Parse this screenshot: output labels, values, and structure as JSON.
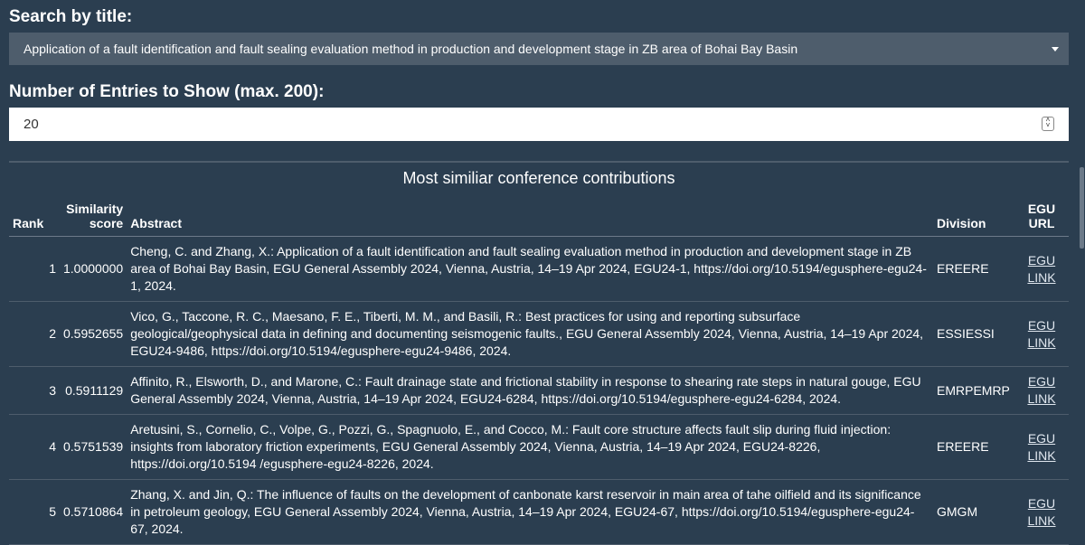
{
  "search_label": "Search by title:",
  "search_value": "Application of a fault identification and fault sealing evaluation method in production and development stage in ZB area of Bohai Bay Basin",
  "entries_label": "Number of Entries to Show (max. 200):",
  "entries_value": "20",
  "table_caption": "Most similiar conference contributions",
  "headers": {
    "rank": "Rank",
    "score_top": "Similarity",
    "score_bottom": "score",
    "abstract": "Abstract",
    "division": "Division",
    "url_top": "EGU",
    "url_bottom": "URL"
  },
  "link_top": "EGU",
  "link_bottom": "LINK",
  "rows": [
    {
      "rank": "1",
      "score": "1.0000000",
      "abstract": "Cheng, C. and Zhang, X.: Application of a fault identification and fault sealing evaluation method in production and development stage in ZB area of Bohai Bay Basin, EGU General Assembly 2024, Vienna, Austria, 14–19 Apr 2024, EGU24-1, https://doi.org/10.5194/egusphere-egu24-1, 2024.",
      "division": "EREERE"
    },
    {
      "rank": "2",
      "score": "0.5952655",
      "abstract": "Vico, G., Taccone, R. C., Maesano, F. E., Tiberti, M. M., and Basili, R.: Best practices for using and reporting subsurface geological/geophysical data in defining and documenting seismogenic faults., EGU General Assembly 2024, Vienna, Austria, 14–19 Apr 2024, EGU24-9486, https://doi.org/10.5194/egusphere-egu24-9486, 2024.",
      "division": "ESSIESSI"
    },
    {
      "rank": "3",
      "score": "0.5911129",
      "abstract": "Affinito, R., Elsworth, D., and Marone, C.: Fault drainage state and frictional stability in response to shearing rate steps in natural gouge, EGU General Assembly 2024, Vienna, Austria, 14–19 Apr 2024, EGU24-6284, https://doi.org/10.5194/egusphere-egu24-6284, 2024.",
      "division": "EMRPEMRP"
    },
    {
      "rank": "4",
      "score": "0.5751539",
      "abstract": "Aretusini, S., Cornelio, C., Volpe, G., Pozzi, G., Spagnuolo, E., and Cocco, M.: Fault core structure affects fault slip during fluid injection: insights from laboratory friction experiments, EGU General Assembly 2024, Vienna, Austria, 14–19 Apr 2024, EGU24-8226, https://doi.org/10.5194 /egusphere-egu24-8226, 2024.",
      "division": "EREERE"
    },
    {
      "rank": "5",
      "score": "0.5710864",
      "abstract": "Zhang, X. and Jin, Q.: The influence of faults on the development of canbonate karst reservoir in main area of tahe oilfield and its significance in petroleum geology, EGU General Assembly 2024, Vienna, Austria, 14–19 Apr 2024, EGU24-67, https://doi.org/10.5194/egusphere-egu24-67, 2024.",
      "division": "GMGM"
    }
  ]
}
